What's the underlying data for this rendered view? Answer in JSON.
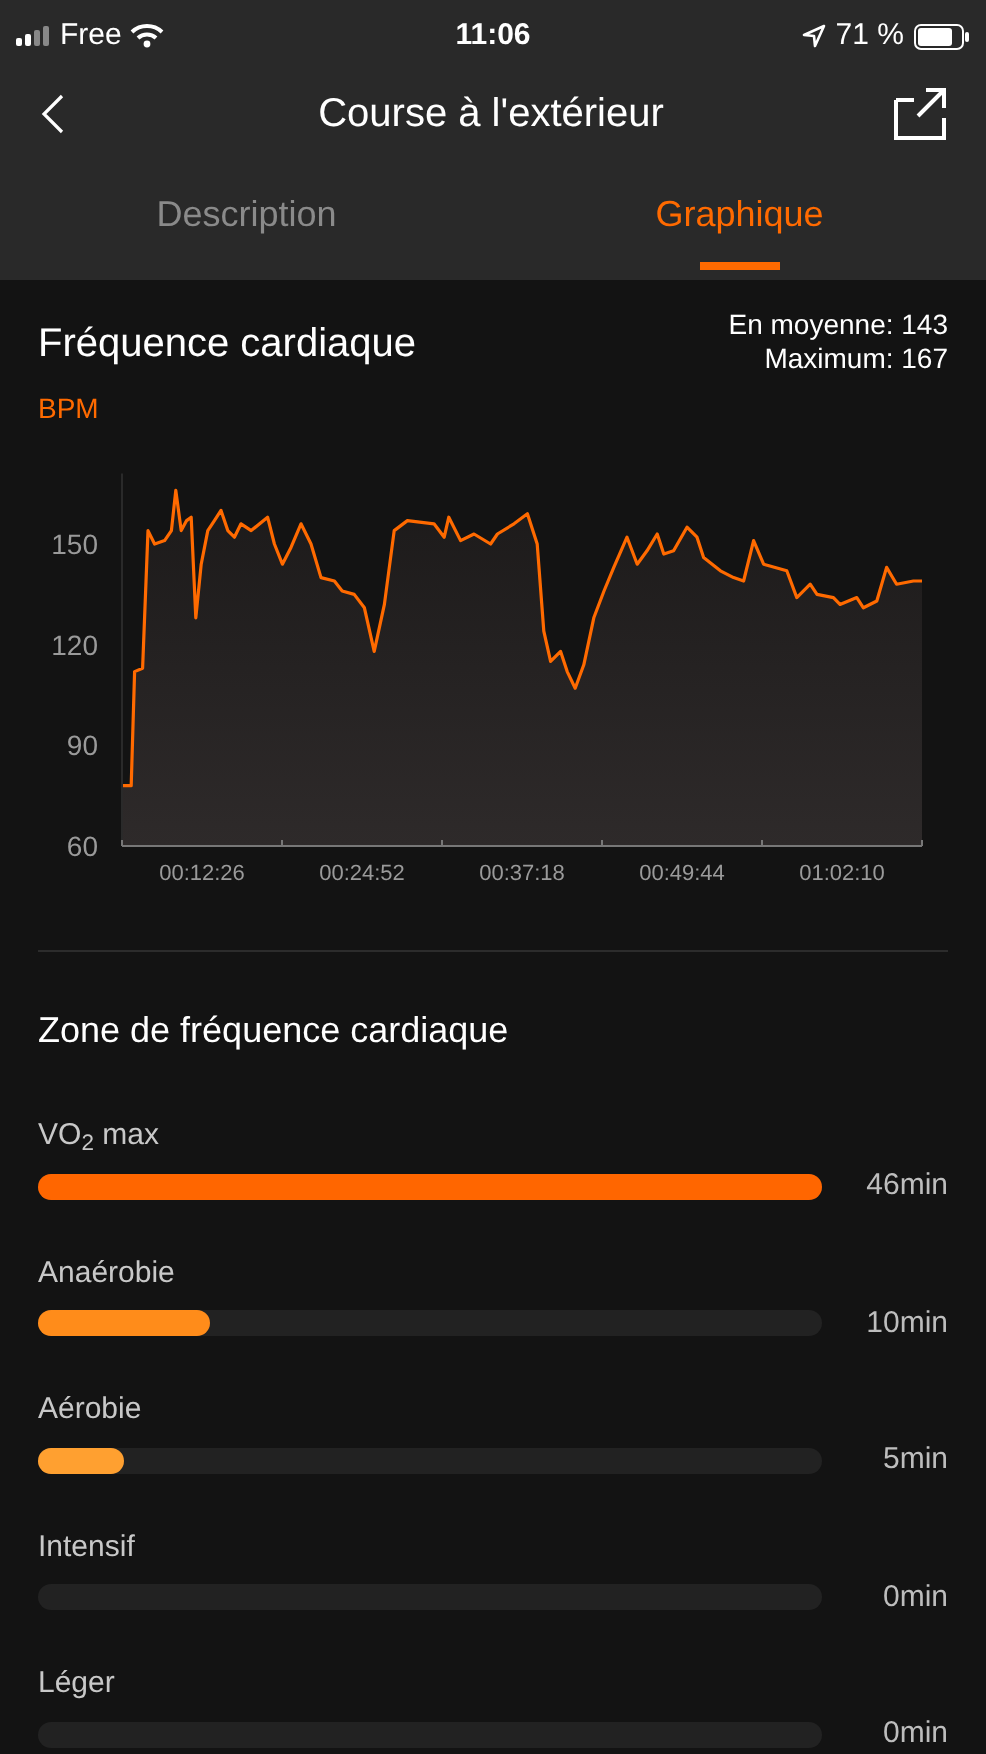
{
  "status_bar": {
    "carrier": "Free",
    "time": "11:06",
    "battery": "71 %"
  },
  "header": {
    "title": "Course à l'extérieur"
  },
  "tabs": [
    {
      "label": "Description",
      "selected": false
    },
    {
      "label": "Graphique",
      "selected": true
    }
  ],
  "heart_rate": {
    "title": "Fréquence cardiaque",
    "average": "En moyenne: 143",
    "maximum": "Maximum: 167",
    "chart_data": {
      "type": "area",
      "ylabel": "BPM",
      "xlim": [
        373,
        4103
      ],
      "ylim": [
        60,
        171
      ],
      "yticks": [
        60,
        90,
        120,
        150
      ],
      "xticks": [
        {
          "value": 746,
          "label": "00:12:26"
        },
        {
          "value": 1492,
          "label": "00:24:52"
        },
        {
          "value": 2238,
          "label": "00:37:18"
        },
        {
          "value": 2984,
          "label": "00:49:44"
        },
        {
          "value": 3730,
          "label": "01:02:10"
        }
      ],
      "x": [
        373,
        416,
        432,
        469,
        494,
        525,
        572,
        603,
        624,
        649,
        674,
        696,
        717,
        742,
        773,
        804,
        835,
        866,
        897,
        928,
        975,
        1052,
        1084,
        1121,
        1161,
        1208,
        1254,
        1301,
        1363,
        1400,
        1456,
        1503,
        1549,
        1596,
        1642,
        1704,
        1828,
        1875,
        1897,
        1952,
        2014,
        2092,
        2123,
        2201,
        2263,
        2309,
        2340,
        2371,
        2418,
        2449,
        2486,
        2526,
        2573,
        2620,
        2666,
        2728,
        2775,
        2821,
        2868,
        2899,
        2945,
        3007,
        3054,
        3085,
        3163,
        3225,
        3271,
        3318,
        3364,
        3473,
        3519,
        3582,
        3613,
        3690,
        3721,
        3799,
        3830,
        3892,
        3938,
        3985,
        4063,
        4103
      ],
      "series": [
        {
          "color": "#ff6a00",
          "values": [
            78,
            78,
            112,
            113,
            154,
            150,
            151,
            154,
            166,
            154,
            157,
            158,
            128,
            144,
            154,
            157,
            160,
            154,
            152,
            156,
            154,
            158,
            150,
            144,
            149,
            156,
            150,
            140,
            139,
            136,
            135,
            131,
            118,
            132,
            154,
            157,
            156,
            152,
            158,
            151,
            153,
            150,
            153,
            156,
            159,
            150,
            124,
            115,
            118,
            112,
            107,
            114,
            128,
            136,
            143,
            152,
            144,
            148,
            153,
            147,
            148,
            155,
            152,
            146,
            142,
            140,
            139,
            151,
            144,
            142,
            134,
            138,
            135,
            134,
            132,
            134,
            131,
            133,
            143,
            138,
            139,
            139
          ]
        }
      ]
    }
  },
  "zones": {
    "title": "Zone de fréquence cardiaque",
    "items": [
      {
        "label": "VO$_{2}$ max",
        "level": 1,
        "color": "#ff6600",
        "duration": "46min"
      },
      {
        "label": "Anaérobie",
        "level": 0.22,
        "color": "#ff8c1a",
        "duration": "10min"
      },
      {
        "label": "Aérobie",
        "level": 0.11,
        "color": "#ffa030",
        "duration": "5min"
      },
      {
        "label": "Intensif",
        "duration": "0min"
      },
      {
        "label": "Léger",
        "duration": "0min"
      }
    ]
  }
}
